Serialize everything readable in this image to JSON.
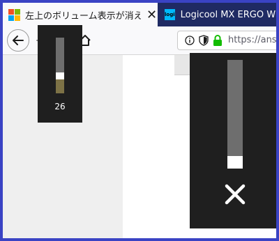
{
  "tabs": [
    {
      "label": "左上のボリューム表示が消えた。 -",
      "active": true
    },
    {
      "label": "Logicool MX ERGO Wireless",
      "active": false
    }
  ],
  "tab_icons": {
    "logi_text": "logi"
  },
  "urlbar": {
    "url": "https://answ"
  },
  "volume_osd_small": {
    "value_text": "26",
    "level_fraction": 0.26
  },
  "volume_osd_large": {
    "state": "muted"
  },
  "colors": {
    "accent": "#3a43c4",
    "tabstrip": "#1f2a63",
    "osd_bg": "#1f1f1f",
    "lock_green": "#12bc00"
  }
}
